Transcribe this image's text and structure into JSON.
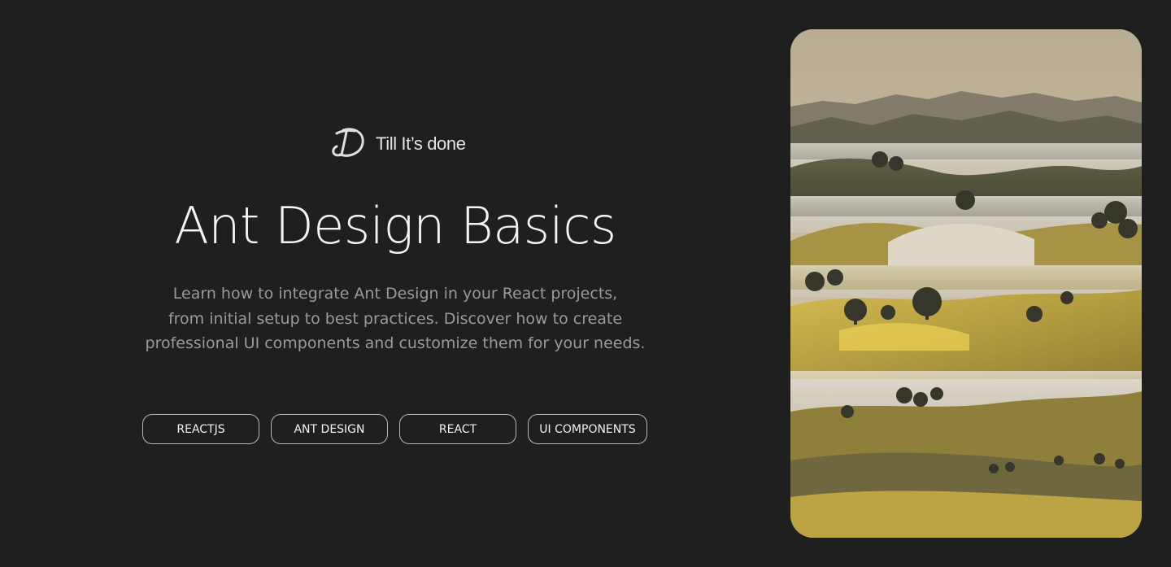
{
  "brand": {
    "name": "Till It’s done",
    "logo_icon": "td-monogram-icon"
  },
  "hero": {
    "title": "Ant Design Basics",
    "description_lines": [
      "Learn how to integrate Ant Design in your React projects,",
      "from initial setup to best practices. Discover how to create",
      "professional UI components and customize them for your needs."
    ]
  },
  "tags": [
    {
      "label": "REACTJS"
    },
    {
      "label": "ANT DESIGN"
    },
    {
      "label": "REACT"
    },
    {
      "label": "UI COMPONENTS"
    }
  ],
  "image": {
    "icon": "misty-hills-landscape-image"
  },
  "colors": {
    "background": "#1f1f1f",
    "text_primary": "#f4f4f4",
    "text_secondary": "#9a9a9a",
    "tag_border": "#b8b8b8"
  }
}
